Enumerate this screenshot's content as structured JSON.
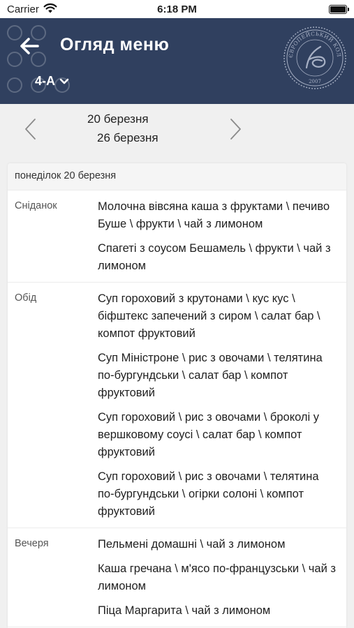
{
  "status_bar": {
    "carrier": "Carrier",
    "time": "6:18 PM"
  },
  "header": {
    "title": "Огляд меню",
    "class_selector": "4-А",
    "logo_text": "ЄВРОПЕЙСЬКИЙ КОЛЕГІУМ",
    "logo_year": "2007"
  },
  "week_nav": {
    "start": "20 березня",
    "end": "26 березня"
  },
  "day": {
    "title": "понеділок 20 березня",
    "meals": [
      {
        "name": "Сніданок",
        "options": [
          "Молочна вівсяна каша з фруктами \\ печиво Буше \\ фрукти \\ чай з лимоном",
          "Спагеті з соусом Бешамель \\ фрукти \\ чай з лимоном"
        ]
      },
      {
        "name": "Обід",
        "options": [
          "Суп гороховий з крутонами \\ кус кус \\ біфштекс запечений з сиром \\ салат бар \\ компот фруктовий",
          "Суп Міністроне \\ рис з овочами \\ телятина по-бургундськи \\ салат бар \\ компот фруктовий",
          "Суп гороховий \\ рис з овочами \\ броколі у вершковому соусі \\ салат бар \\ компот фруктовий",
          "Суп гороховий \\ рис з овочами \\ телятина по-бургундськи \\ огірки солоні \\ компот фруктовий"
        ]
      },
      {
        "name": "Вечеря",
        "options": [
          "Пельмені домашні \\ чай з лимоном",
          "Каша гречана \\ м'ясо по-французськи \\ чай з лимоном",
          "Піца Маргарита \\ чай з лимоном"
        ]
      }
    ]
  },
  "colors": {
    "header_bg": "#30405f",
    "background": "#f0f0f0",
    "card_bg": "#ffffff"
  },
  "icons": {
    "back": "arrow-left-icon",
    "dropdown": "chevron-down-icon",
    "prev": "chevron-left-icon",
    "next": "chevron-right-icon",
    "wifi": "wifi-icon",
    "battery": "battery-icon"
  }
}
